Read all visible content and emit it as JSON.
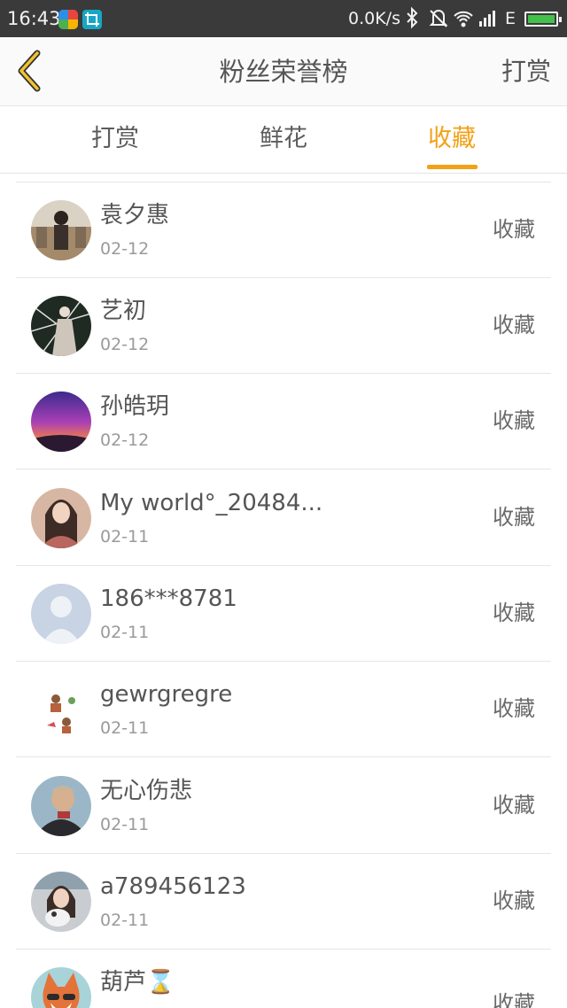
{
  "status_bar": {
    "time": "16:43",
    "network_speed": "0.0K/s",
    "network_type": "E",
    "icons": [
      "app-icon-1",
      "crop-app-icon",
      "bluetooth-icon",
      "mute-bell-icon",
      "wifi-icon",
      "signal-icon",
      "battery-charging-icon"
    ],
    "battery_color": "#43c04b"
  },
  "header": {
    "back_icon": "chevron-left-icon",
    "back_color": "#f2c230",
    "title": "粉丝荣誉榜",
    "action_label": "打赏"
  },
  "tabs": [
    {
      "label": "打赏",
      "active": false
    },
    {
      "label": "鲜花",
      "active": false
    },
    {
      "label": "收藏",
      "active": true
    }
  ],
  "accent_color": "#f2a118",
  "list": [
    {
      "name": "袁夕惠",
      "date": "02-12",
      "action": "收藏"
    },
    {
      "name": "艺初",
      "date": "02-12",
      "action": "收藏"
    },
    {
      "name": "孙皓玥",
      "date": "02-12",
      "action": "收藏"
    },
    {
      "name": "My world°_20484...",
      "date": "02-11",
      "action": "收藏"
    },
    {
      "name": "186***8781",
      "date": "02-11",
      "action": "收藏"
    },
    {
      "name": "gewrgregre",
      "date": "02-11",
      "action": "收藏"
    },
    {
      "name": "无心伤悲",
      "date": "02-11",
      "action": "收藏"
    },
    {
      "name": "a789456123",
      "date": "02-11",
      "action": "收藏"
    },
    {
      "name": "葫芦⌛",
      "date": "",
      "action": "收藏"
    }
  ]
}
